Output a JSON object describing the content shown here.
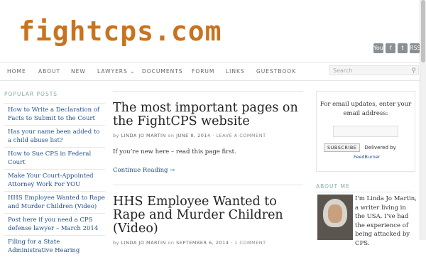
{
  "site": {
    "logo": "fightcps.com"
  },
  "social": [
    "YouTube",
    "f",
    "t",
    "RSS"
  ],
  "nav": {
    "items": [
      "HOME",
      "ABOUT",
      "NEW",
      "LAWYERS",
      "DOCUMENTS",
      "FORUM",
      "LINKS",
      "GUESTBOOK"
    ],
    "lawyers_caret": "⌄",
    "search_placeholder": "Search"
  },
  "sidebar": {
    "title": "POPULAR POSTS",
    "links": [
      "How to Write a Declaration of Facts to Submit to the Court",
      "Has your name been added to a child abuse list?",
      "How to Sue CPS in Federal Court",
      "Make Your Court-Appointed Attorney Work For YOU",
      "HHS Employee Wanted to Rape and Murder Children (Video)",
      "Post here if you need a CPS defense lawyer – March 2014",
      "Filing for a State Administrative Hearing"
    ]
  },
  "posts": [
    {
      "title": "The most important pages on the FightCPS website",
      "by": "by",
      "author": "LINDA JO MARTIN",
      "on": "on",
      "date": "JUNE 8, 2014",
      "sep": "·",
      "comments": "LEAVE A COMMENT",
      "excerpt": "If you’re new here – read this page first.",
      "more": "Continue Reading →"
    },
    {
      "title": "HHS Employee Wanted to Rape and Murder Children (Video)",
      "by": "by",
      "author": "LINDA JO MARTIN",
      "on": "on",
      "date": "SEPTEMBER 6, 2014",
      "sep": "·",
      "comments": "1 COMMENT"
    }
  ],
  "email_widget": {
    "intro": "For email updates, enter your email address:",
    "subscribe": "SUBSCRIBE",
    "delivered": "Delivered by",
    "feedburner": "FeedBurner"
  },
  "about": {
    "title": "ABOUT ME",
    "text": "I'm Linda Jo Martin, a writer living in the USA. I've had the experience of being attacked by CPS."
  },
  "colors": {
    "logo": "#c8731f",
    "link": "#1e4f8f",
    "muted": "#8aa"
  }
}
